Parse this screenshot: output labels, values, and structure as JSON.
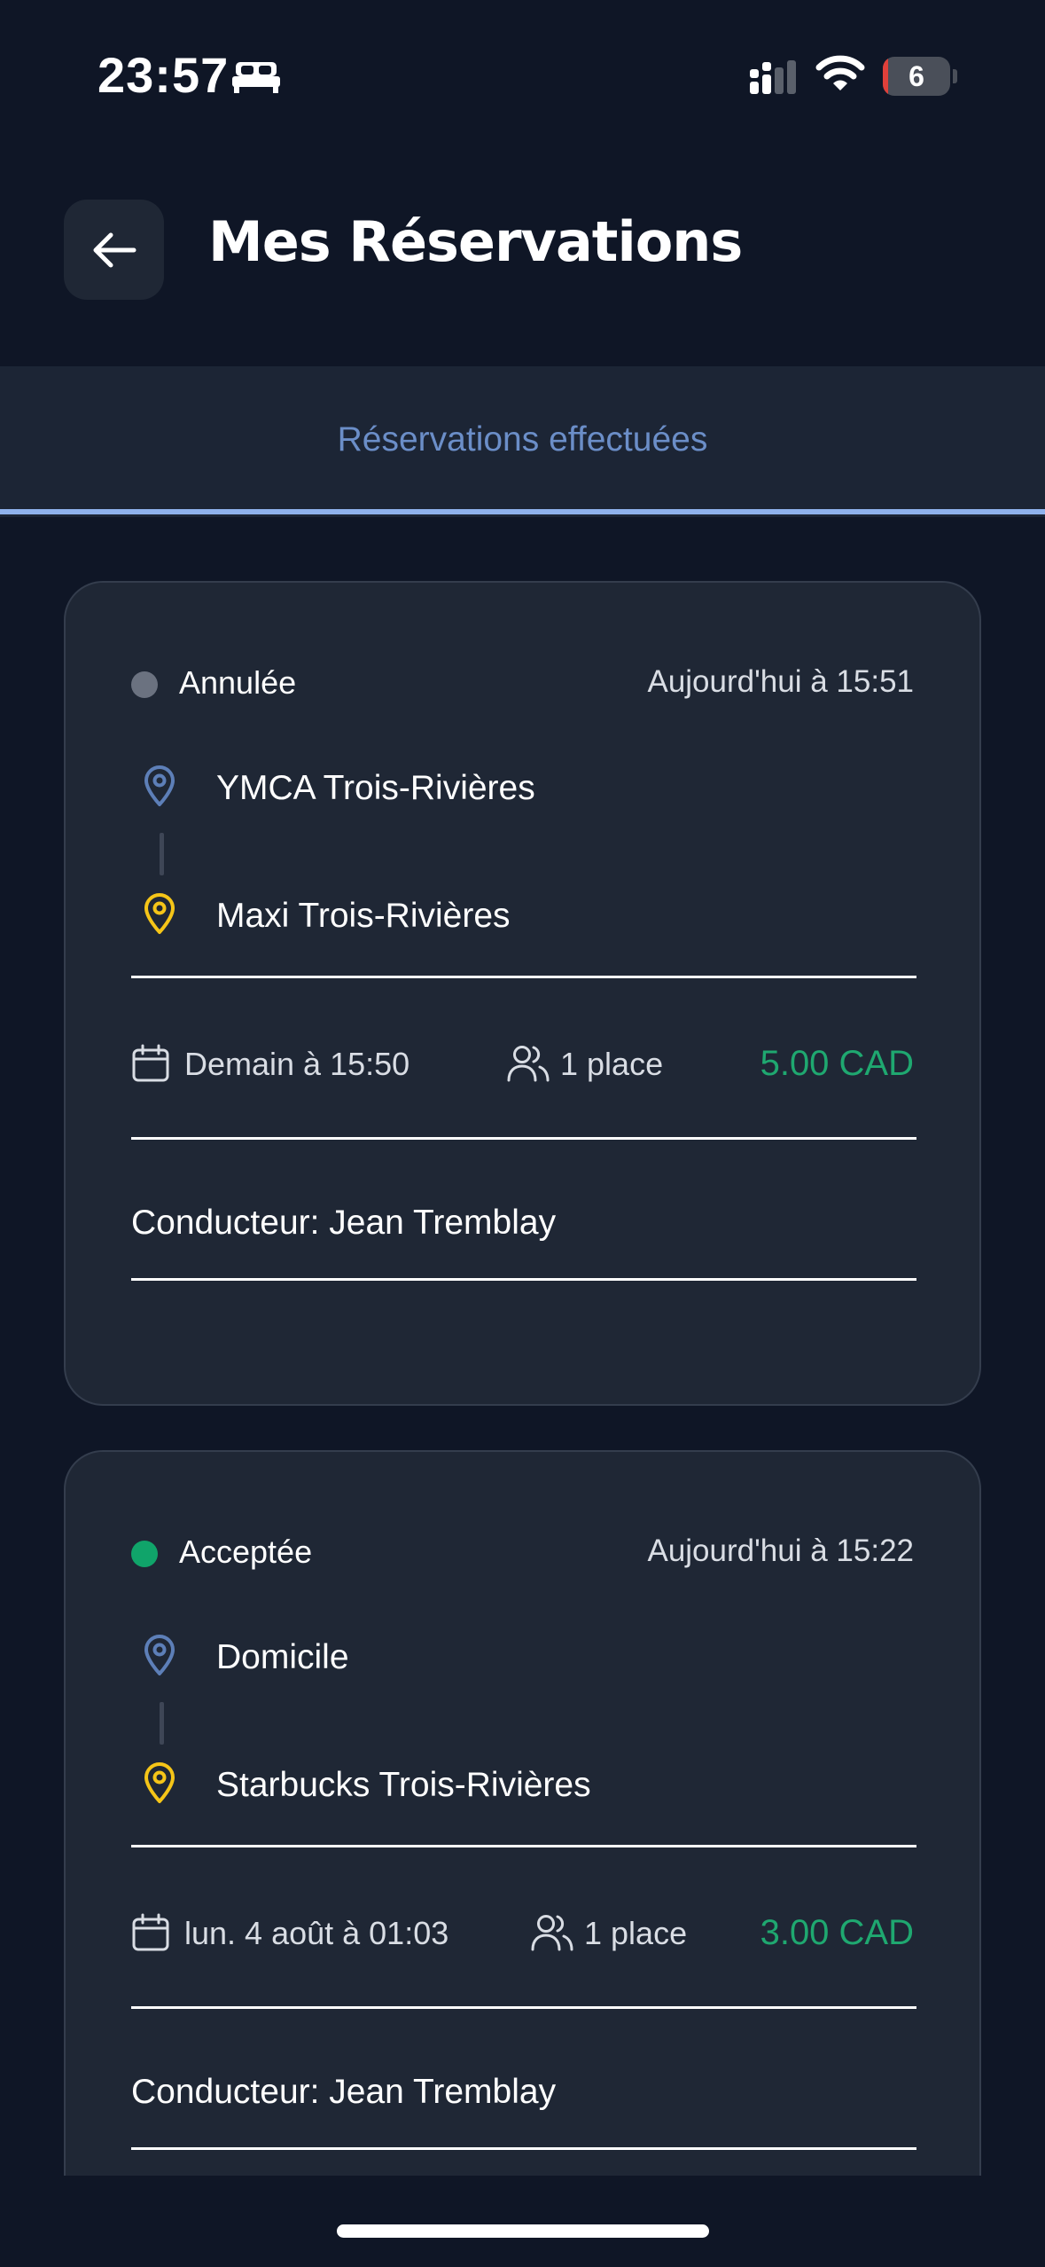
{
  "status_bar": {
    "time": "23:57",
    "battery_level": "6",
    "battery_fraction": 0.06,
    "icons": [
      "bed-icon",
      "signal-icon",
      "wifi-icon",
      "battery-icon"
    ]
  },
  "header": {
    "title": "Mes Réservations",
    "back_icon": "arrow-left-icon"
  },
  "tabs": {
    "active": "Réservations effectuées"
  },
  "colors": {
    "background": "#0f1626",
    "card": "#1f2735",
    "accent_tab": "#6b8ec8",
    "price": "#1fa870",
    "status_cancelled": "#6b7280",
    "status_accepted": "#10a46a",
    "pickup_pin": "#5d7fb8",
    "dropoff_pin": "#f5c518"
  },
  "reservations": [
    {
      "status": "Annulée",
      "status_color": "#6b7280",
      "created_at": "Aujourd'hui à 15:51",
      "pickup": "YMCA Trois-Rivières",
      "dropoff": "Maxi Trois-Rivières",
      "departure": "Demain à 15:50",
      "seats": "1 place",
      "price": "5.00 CAD",
      "driver": "Conducteur: Jean Tremblay"
    },
    {
      "status": "Acceptée",
      "status_color": "#10a46a",
      "created_at": "Aujourd'hui à 15:22",
      "pickup": "Domicile",
      "dropoff": "Starbucks Trois-Rivières",
      "departure": "lun. 4 août à 01:03",
      "seats": "1 place",
      "price": "3.00 CAD",
      "driver": "Conducteur: Jean Tremblay"
    }
  ]
}
